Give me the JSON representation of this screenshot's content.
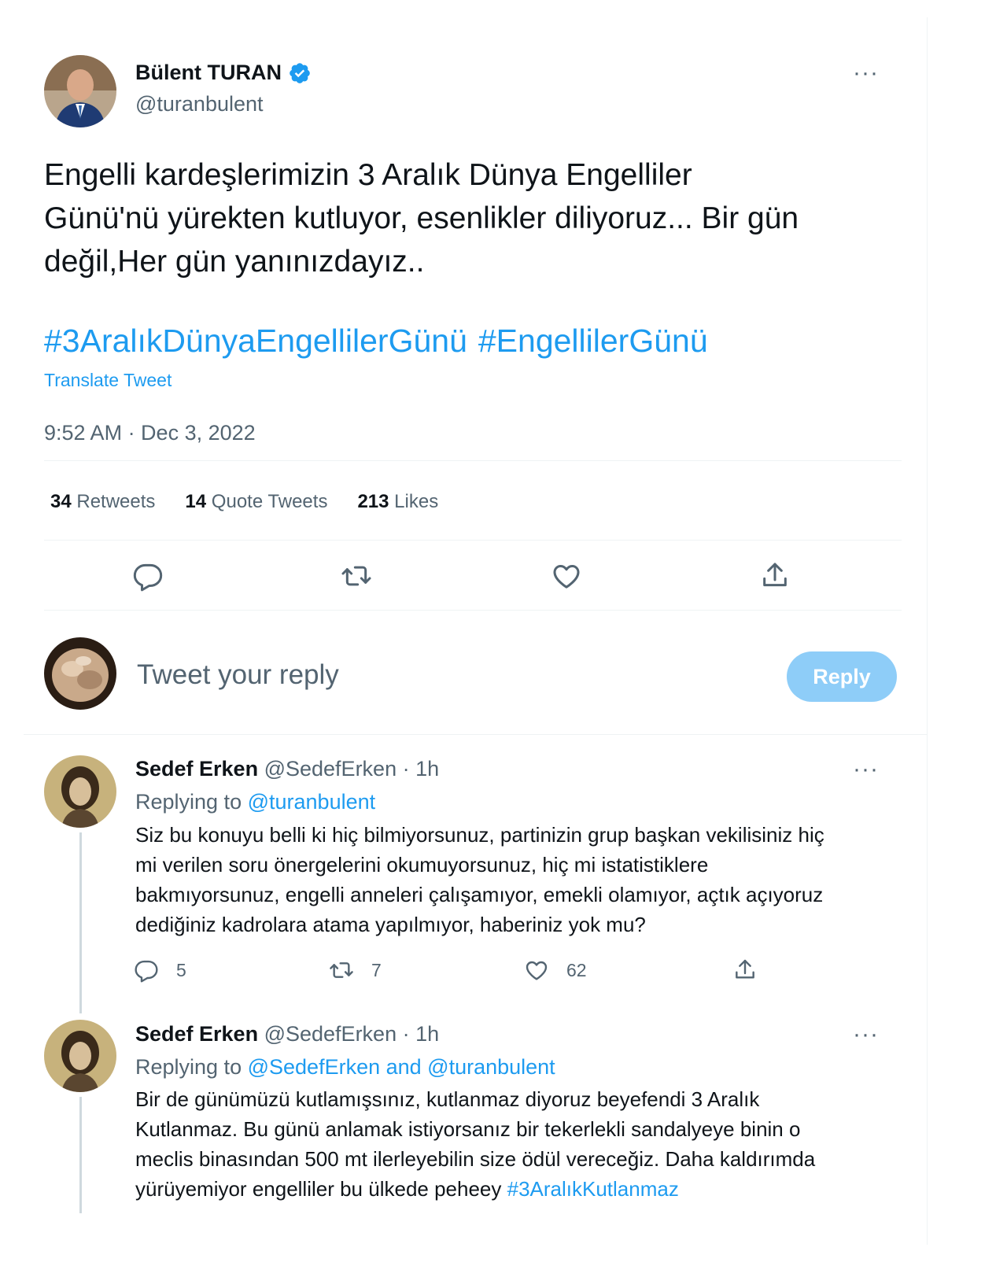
{
  "tweet": {
    "author_name": "Bülent TURAN",
    "author_handle": "@turanbulent",
    "more": "···",
    "text_lines": [
      "Engelli kardeşlerimizin 3 Aralık Dünya Engelliler",
      "Günü'nü yürekten kutluyor, esenlikler diliyoruz... Bir gün",
      "değil,Her gün yanınızdayız.."
    ],
    "hashtags": [
      "#3AralıkDünyaEngellilerGünü",
      "#EngellilerGünü"
    ],
    "translate": "Translate Tweet",
    "timestamp": "9:52 AM · Dec 3, 2022",
    "stats": {
      "retweets_count": "34",
      "retweets_label": "Retweets",
      "quotes_count": "14",
      "quotes_label": "Quote Tweets",
      "likes_count": "213",
      "likes_label": "Likes"
    },
    "actions": [
      "reply-icon",
      "retweet-icon",
      "like-icon",
      "share-icon"
    ]
  },
  "compose": {
    "placeholder": "Tweet your reply",
    "button_label": "Reply"
  },
  "replies": [
    {
      "name": "Sedef Erken",
      "handle": "@SedefErken",
      "time": "· 1h",
      "more": "···",
      "replying_prefix": "Replying to",
      "replying_mention": "@turanbulent",
      "text_lines": [
        "Siz bu konuyu belli ki hiç bilmiyorsunuz, partinizin grup başkan vekilisiniz hiç",
        "mi verilen soru önergelerini okumuyorsunuz, hiç mi istatistiklere",
        "bakmıyorsunuz, engelli anneleri çalışamıyor, emekli olamıyor, açtık açıyoruz",
        "dediğiniz kadrolara atama yapılmıyor, haberiniz yok mu?"
      ],
      "counts": {
        "replies": "5",
        "retweets": "7",
        "likes": "62"
      }
    },
    {
      "name": "Sedef Erken",
      "handle": "@SedefErken",
      "time": "· 1h",
      "more": "···",
      "replying_prefix": "Replying to",
      "replying_mention": "@SedefErken and @turanbulent",
      "text_lines": [
        "Bir de günümüzü kutlamışsınız, kutlanmaz diyoruz beyefendi 3 Aralık",
        "Kutlanmaz. Bu günü anlamak istiyorsanız bir tekerlekli sandalyeye binin o",
        "meclis binasından 500 mt ilerleyebilin size ödül vereceğiz. Daha kaldırımda",
        "yürüyemiyor engelliler bu ülkede peheey "
      ],
      "hashtag": "#3AralıkKutlanmaz"
    }
  ],
  "colors": {
    "accent": "#1d9bf0",
    "secondary_text": "#536471",
    "primary_text": "#0f1419",
    "reply_button_disabled": "#8ecdf8",
    "divider": "#eff3f4"
  }
}
